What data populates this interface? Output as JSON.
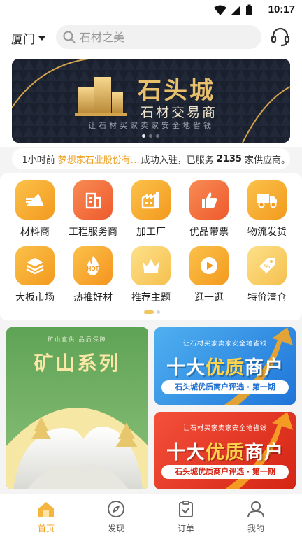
{
  "status_bar": {
    "time": "10:17"
  },
  "header": {
    "city": "厦门",
    "search_placeholder": "石材之美"
  },
  "banner": {
    "title": "石头城",
    "subtitle": "石材交易商",
    "slogan": "让石材买家卖家安全地省钱",
    "dots": 3,
    "active_dot": 1
  },
  "notice": {
    "time_ago": "1小时前",
    "company": "梦想家石业股份有…",
    "middle": "成功入驻，已服务",
    "count": "2135",
    "end": "家供应商。"
  },
  "categories": [
    {
      "label": "材料商",
      "icon": "materials-icon",
      "color": "#f5a623"
    },
    {
      "label": "工程服务商",
      "icon": "building-icon",
      "color": "#f26a3c"
    },
    {
      "label": "加工厂",
      "icon": "factory-icon",
      "color": "#f5a623"
    },
    {
      "label": "优品带票",
      "icon": "thumbs-up-icon",
      "color": "#f26a3c"
    },
    {
      "label": "物流发货",
      "icon": "truck-icon",
      "color": "#f5a623"
    },
    {
      "label": "大板市场",
      "icon": "layers-icon",
      "color": "#f5a623"
    },
    {
      "label": "热推好材",
      "icon": "hot-fire-icon",
      "color": "#f7b235"
    },
    {
      "label": "推荐主题",
      "icon": "crown-icon",
      "color": "#f5c04e"
    },
    {
      "label": "逛一逛",
      "icon": "play-icon",
      "color": "#f5a623"
    },
    {
      "label": "特价清仓",
      "icon": "discount-tag-icon",
      "color": "#f5c04e"
    }
  ],
  "promos": {
    "mine": {
      "title": "矿山系列",
      "tag": "矿山直供 品质保障"
    },
    "top1": {
      "slogan": "让石材买家卖家安全地省钱",
      "big_a": "十大",
      "big_gold": "优质",
      "big_b": "商户",
      "pill": "石头城优质商户评选 · 第一期"
    },
    "top2": {
      "slogan": "让石材买家卖家安全地省钱",
      "big_a": "十大",
      "big_gold": "优质",
      "big_b": "商户",
      "pill": "石头城优质商户评选 · 第一期"
    }
  },
  "tabs": [
    {
      "label": "首页",
      "icon": "home-icon",
      "active": true
    },
    {
      "label": "发现",
      "icon": "compass-icon",
      "active": false
    },
    {
      "label": "订单",
      "icon": "order-clipboard-icon",
      "active": false
    },
    {
      "label": "我的",
      "icon": "profile-icon",
      "active": false
    }
  ],
  "colors": {
    "accent": "#f0a020",
    "banner_bg": "#1c2230",
    "gold": "#e8c06c"
  }
}
